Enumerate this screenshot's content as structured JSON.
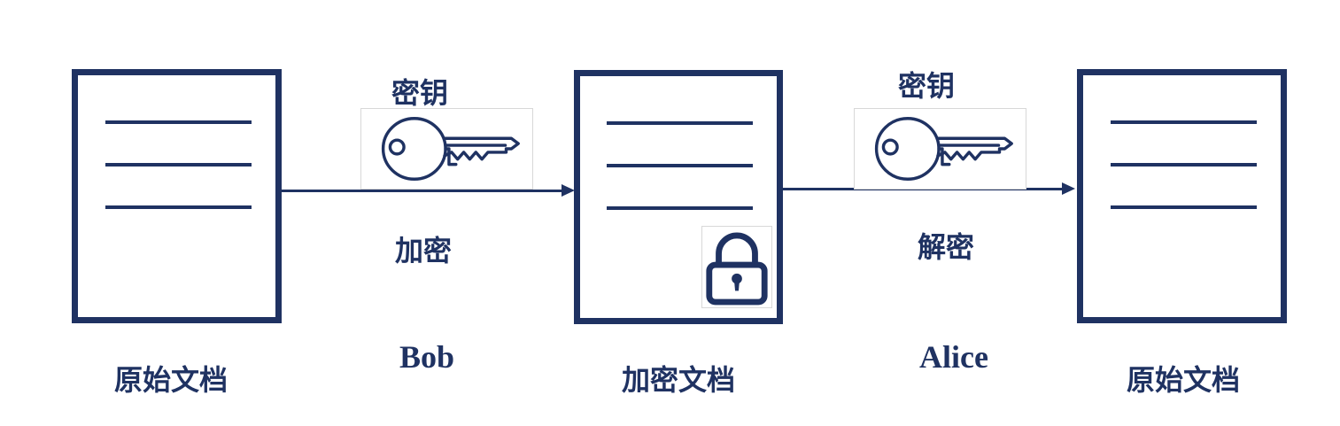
{
  "colors": {
    "primary": "#1f3262"
  },
  "documents": {
    "original_left": {
      "label": "原始文档"
    },
    "encrypted": {
      "label": "加密文档",
      "badge_icon": "lock-icon"
    },
    "original_right": {
      "label": "原始文档"
    }
  },
  "steps": {
    "encrypt": {
      "key_label": "密钥",
      "key_icon": "key-icon",
      "action_label": "加密",
      "actor": "Bob"
    },
    "decrypt": {
      "key_label": "密钥",
      "key_icon": "key-icon",
      "action_label": "解密",
      "actor": "Alice"
    }
  }
}
